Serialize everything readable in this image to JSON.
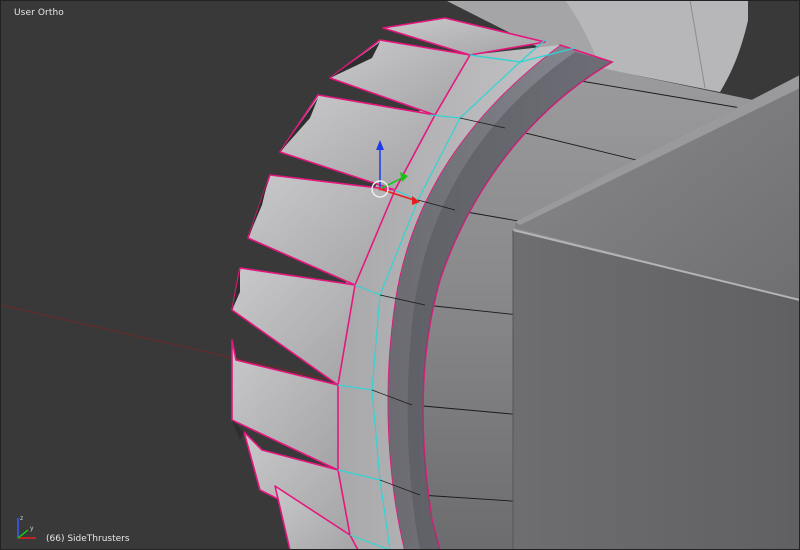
{
  "viewport": {
    "view_name": "User Ortho",
    "object_info": "(66) SideThrusters"
  },
  "colors": {
    "background": "#393939",
    "selection_edge": "#e5177f",
    "active_loop": "#32d3d3",
    "manip_z": "#1d3be8",
    "manip_y": "#16c416",
    "manip_x": "#e81d1d",
    "origin_dot": "#ff2a2a",
    "grid_x_axis": "#7a2a2a"
  },
  "icons": {
    "axis_widget": "axis-orientation-icon",
    "manipulator": "transform-manipulator-icon",
    "pivot": "pivot-circle-icon"
  }
}
